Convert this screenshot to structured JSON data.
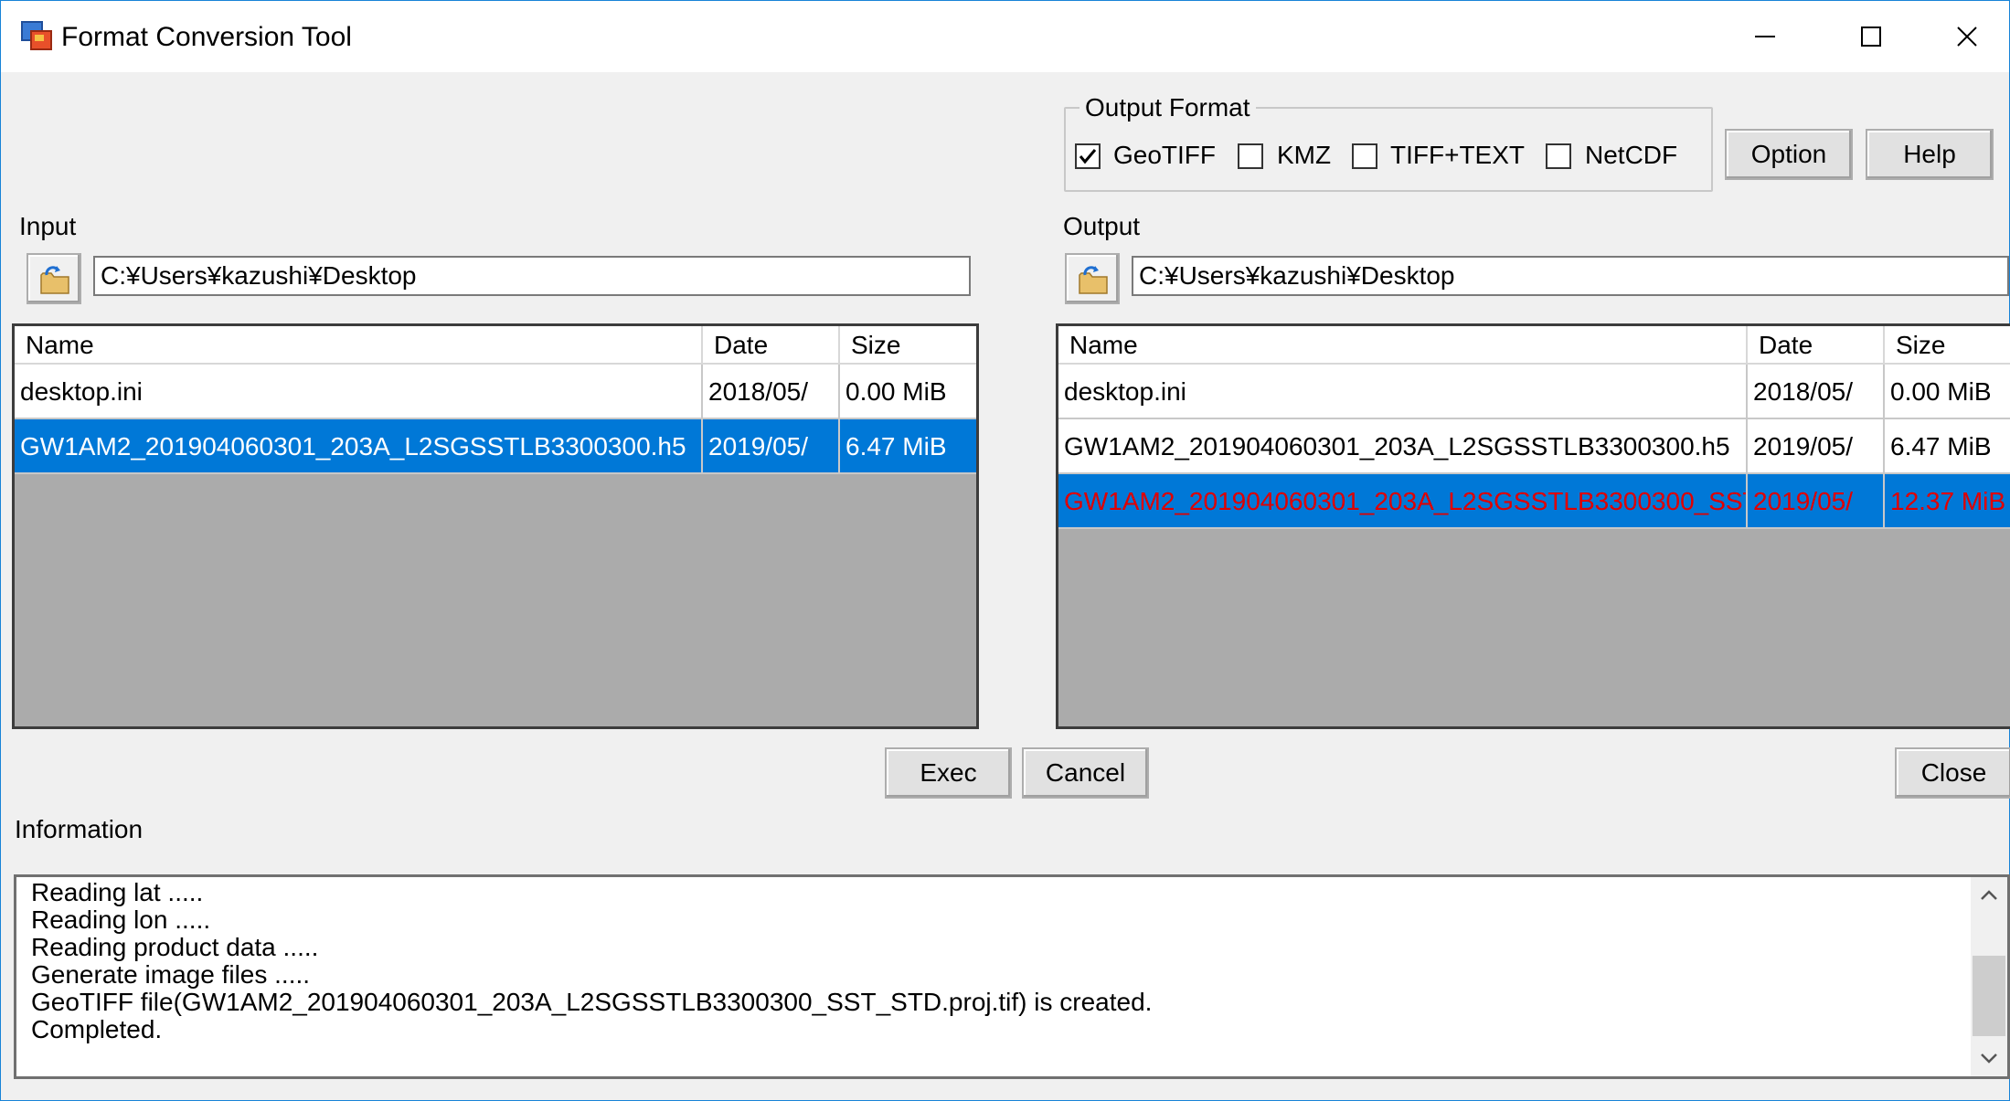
{
  "window": {
    "title": "Format Conversion Tool"
  },
  "output_format": {
    "title": "Output Format",
    "options": [
      {
        "label": "GeoTIFF",
        "checked": true
      },
      {
        "label": "KMZ",
        "checked": false
      },
      {
        "label": "TIFF+TEXT",
        "checked": false
      },
      {
        "label": "NetCDF",
        "checked": false
      }
    ]
  },
  "buttons": {
    "option": "Option",
    "help": "Help",
    "exec": "Exec",
    "cancel": "Cancel",
    "close": "Close"
  },
  "input": {
    "label": "Input",
    "path": "C:¥Users¥kazushi¥Desktop",
    "columns": [
      "Name",
      "Date",
      "Size"
    ],
    "rows": [
      {
        "name": "desktop.ini",
        "date": "2018/05/",
        "size": "0.00 MiB"
      },
      {
        "name": "GW1AM2_201904060301_203A_L2SGSSTLB3300300.h5",
        "date": "2019/05/",
        "size": "6.47 MiB"
      }
    ]
  },
  "output": {
    "label": "Output",
    "path": "C:¥Users¥kazushi¥Desktop",
    "columns": [
      "Name",
      "Date",
      "Size"
    ],
    "rows": [
      {
        "name": "desktop.ini",
        "date": "2018/05/",
        "size": "0.00 MiB"
      },
      {
        "name": "GW1AM2_201904060301_203A_L2SGSSTLB3300300.h5",
        "date": "2019/05/",
        "size": "6.47 MiB"
      },
      {
        "name": "GW1AM2_201904060301_203A_L2SGSSTLB3300300_SST...",
        "date": "2019/05/",
        "size": "12.37 MiB"
      }
    ]
  },
  "information": {
    "label": "Information",
    "lines": [
      "Reading lat .....",
      "Reading lon .....",
      "Reading product data .....",
      "Generate image files .....",
      "GeoTIFF file(GW1AM2_201904060301_203A_L2SGSSTLB3300300_SST_STD.proj.tif) is created.",
      "Completed."
    ]
  },
  "colors": {
    "selection": "#0078d7",
    "highlight_text": "#e00000",
    "list_background": "#ababab"
  }
}
